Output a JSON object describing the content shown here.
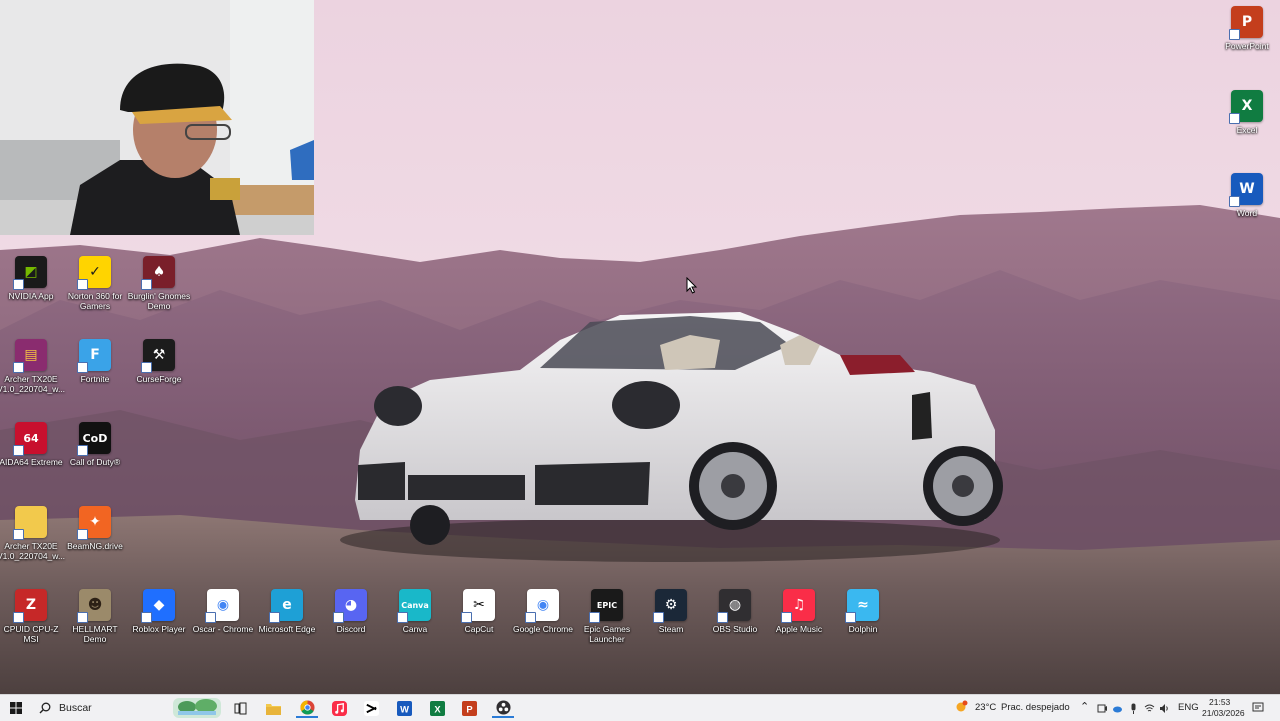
{
  "desktop": {
    "left_icons": [
      {
        "label": "NVIDIA App",
        "icon": "nvidia-icon",
        "color": "#1a1a1a",
        "glyph": "◩",
        "fg": "#76b900"
      },
      {
        "label": "Norton 360 for Gamers",
        "icon": "norton-icon",
        "color": "#ffd400",
        "glyph": "✓",
        "fg": "#1b1b1b"
      },
      {
        "label": "Burglin' Gnomes Demo",
        "icon": "gnome-icon",
        "color": "#7a1f2a",
        "glyph": "♠",
        "fg": "#ffffff"
      },
      {
        "label": "Archer TX20E V1.0_220704_w...",
        "icon": "winrar-icon",
        "color": "#8a2c6f",
        "glyph": "▤",
        "fg": "#f5c542"
      },
      {
        "label": "Fortnite",
        "icon": "fortnite-icon",
        "color": "#3aa3e8",
        "glyph": "F",
        "fg": "#ffffff"
      },
      {
        "label": "CurseForge",
        "icon": "curseforge-icon",
        "color": "#1c1c1c",
        "glyph": "⚒",
        "fg": "#ffffff"
      },
      {
        "label": "AIDA64 Extreme",
        "icon": "aida64-icon",
        "color": "#c8102e",
        "glyph": "64",
        "fg": "#ffffff"
      },
      {
        "label": "Call of Duty®",
        "icon": "callofduty-icon",
        "color": "#111111",
        "glyph": "CoD",
        "fg": "#ffffff"
      },
      {
        "label": "Archer TX20E V1.0_220704_w...",
        "icon": "folder-icon",
        "color": "#f2c94c",
        "glyph": "",
        "fg": "#ffffff"
      },
      {
        "label": "BeamNG.drive",
        "icon": "beamng-icon",
        "color": "#f26522",
        "glyph": "✦",
        "fg": "#ffffff"
      }
    ],
    "bottom_icons": [
      {
        "label": "CPUID CPU-Z MSI",
        "icon": "cpuz-icon",
        "color": "#c62828",
        "glyph": "Z",
        "fg": "#ffffff"
      },
      {
        "label": "HELLMART Demo",
        "icon": "hellmart-icon",
        "color": "#9b8a6a",
        "glyph": "☻",
        "fg": "#2d2116"
      },
      {
        "label": "Roblox Player",
        "icon": "roblox-icon",
        "color": "#1f6fff",
        "glyph": "◆",
        "fg": "#ffffff"
      },
      {
        "label": "Oscar - Chrome",
        "icon": "chrome-icon",
        "color": "#ffffff",
        "glyph": "◉",
        "fg": "#4285f4"
      },
      {
        "label": "Microsoft Edge",
        "icon": "edge-icon",
        "color": "#1ea0d6",
        "glyph": "e",
        "fg": "#ffffff"
      },
      {
        "label": "Discord",
        "icon": "discord-icon",
        "color": "#5865f2",
        "glyph": "◕",
        "fg": "#ffffff"
      },
      {
        "label": "Canva",
        "icon": "canva-icon",
        "color": "#19b8c9",
        "glyph": "Canva",
        "fg": "#ffffff"
      },
      {
        "label": "CapCut",
        "icon": "capcut-icon",
        "color": "#ffffff",
        "glyph": "✂",
        "fg": "#000000"
      },
      {
        "label": "Google Chrome",
        "icon": "chrome-icon",
        "color": "#ffffff",
        "glyph": "◉",
        "fg": "#4285f4"
      },
      {
        "label": "Epic Games Launcher",
        "icon": "epic-games-icon",
        "color": "#1a1a1a",
        "glyph": "EPIC",
        "fg": "#ffffff"
      },
      {
        "label": "Steam",
        "icon": "steam-icon",
        "color": "#1b2838",
        "glyph": "⚙",
        "fg": "#ffffff"
      },
      {
        "label": "OBS Studio",
        "icon": "obs-icon",
        "color": "#302e31",
        "glyph": "◍",
        "fg": "#ffffff"
      },
      {
        "label": "Apple Music",
        "icon": "apple-music-icon",
        "color": "#fa2d48",
        "glyph": "♫",
        "fg": "#ffffff"
      },
      {
        "label": "Dolphin",
        "icon": "dolphin-icon",
        "color": "#3ab8f0",
        "glyph": "≈",
        "fg": "#ffffff"
      }
    ],
    "right_icons": [
      {
        "label": "PowerPoint",
        "icon": "powerpoint-icon",
        "color": "#c43e1c",
        "glyph": "P",
        "fg": "#ffffff"
      },
      {
        "label": "Excel",
        "icon": "excel-icon",
        "color": "#107c41",
        "glyph": "X",
        "fg": "#ffffff"
      },
      {
        "label": "Word",
        "icon": "word-icon",
        "color": "#185abd",
        "glyph": "W",
        "fg": "#ffffff"
      }
    ]
  },
  "taskbar": {
    "search_placeholder": "Buscar",
    "pinned": [
      "start-icon",
      "search-icon",
      "widgets-icon",
      "task-view-icon",
      "file-explorer-icon",
      "chrome-icon",
      "apple-music-icon",
      "capcut-icon",
      "word-icon",
      "excel-icon",
      "powerpoint-icon",
      "obs-icon"
    ],
    "weather_temp": "23°C",
    "weather_desc": "Prac. despejado",
    "language": "ENG",
    "time": "21:53",
    "date": "21/03/2026"
  }
}
